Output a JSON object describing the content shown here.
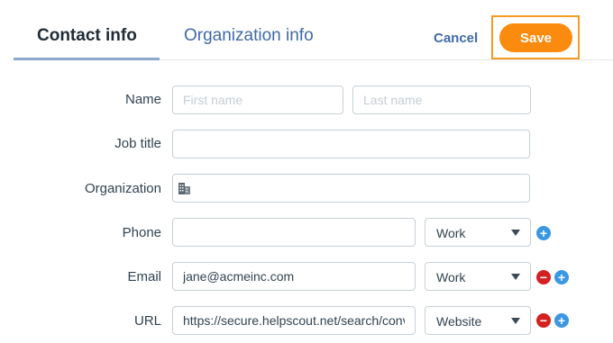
{
  "tabs": {
    "contact": "Contact info",
    "organization": "Organization info"
  },
  "actions": {
    "cancel": "Cancel",
    "save": "Save"
  },
  "form": {
    "name_label": "Name",
    "first_name_placeholder": "First name",
    "last_name_placeholder": "Last name",
    "job_title_label": "Job title",
    "organization_label": "Organization",
    "organization_icon": "building-icon",
    "phone_label": "Phone",
    "phone_value": "",
    "phone_type": "Work",
    "email_label": "Email",
    "email_value": "jane@acmeinc.com",
    "email_type": "Work",
    "url_label": "URL",
    "url_value": "https://secure.helpscout.net/search/conv",
    "url_type": "Website"
  },
  "colors": {
    "accent": "#fb8b0e",
    "link": "#3f6aa5",
    "add": "#3a97e4",
    "remove": "#d42020"
  }
}
